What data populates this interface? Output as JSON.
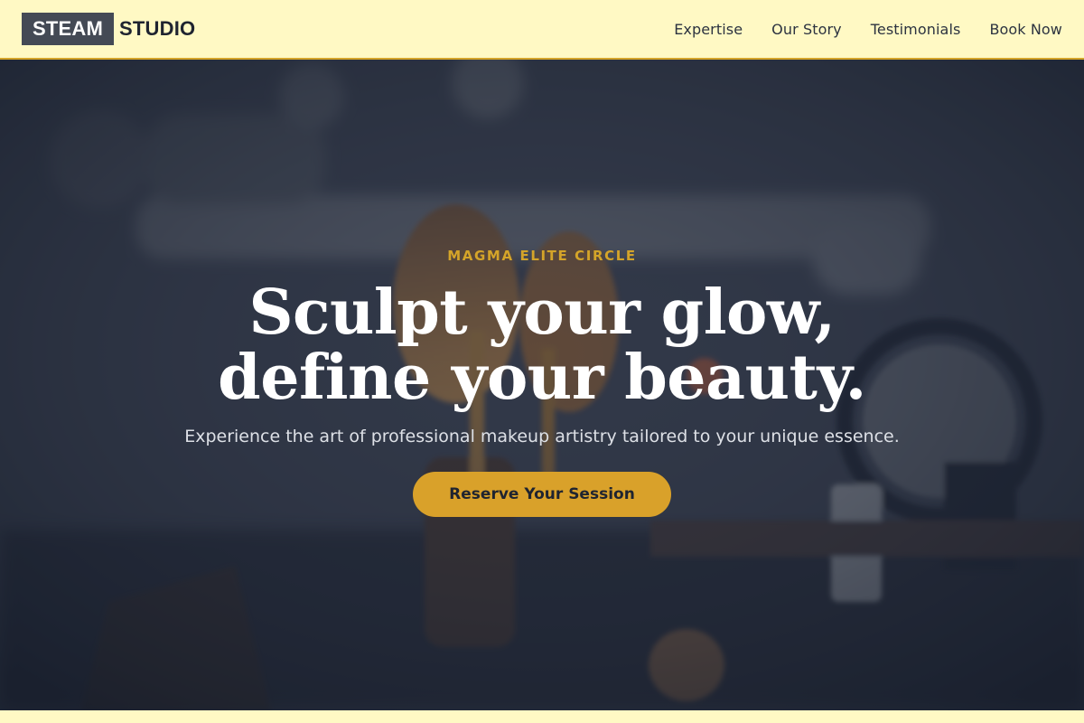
{
  "header": {
    "brand_box": "STEAM",
    "brand_rest": "STUDIO",
    "nav": [
      "Expertise",
      "Our Story",
      "Testimonials",
      "Book Now"
    ]
  },
  "hero": {
    "eyebrow": "MAGMA ELITE CIRCLE",
    "headline": "Sculpt your glow, define your beauty.",
    "subheading": "Experience the art of professional makeup artistry tailored to your unique essence.",
    "cta_label": "Reserve Your Session",
    "background_image": "makeup-brushes-photo"
  },
  "colors": {
    "header_bg": "#fff9c4",
    "accent": "#d4a429",
    "brand_box_bg": "#444a55",
    "hero_overlay": "#1a2030"
  }
}
